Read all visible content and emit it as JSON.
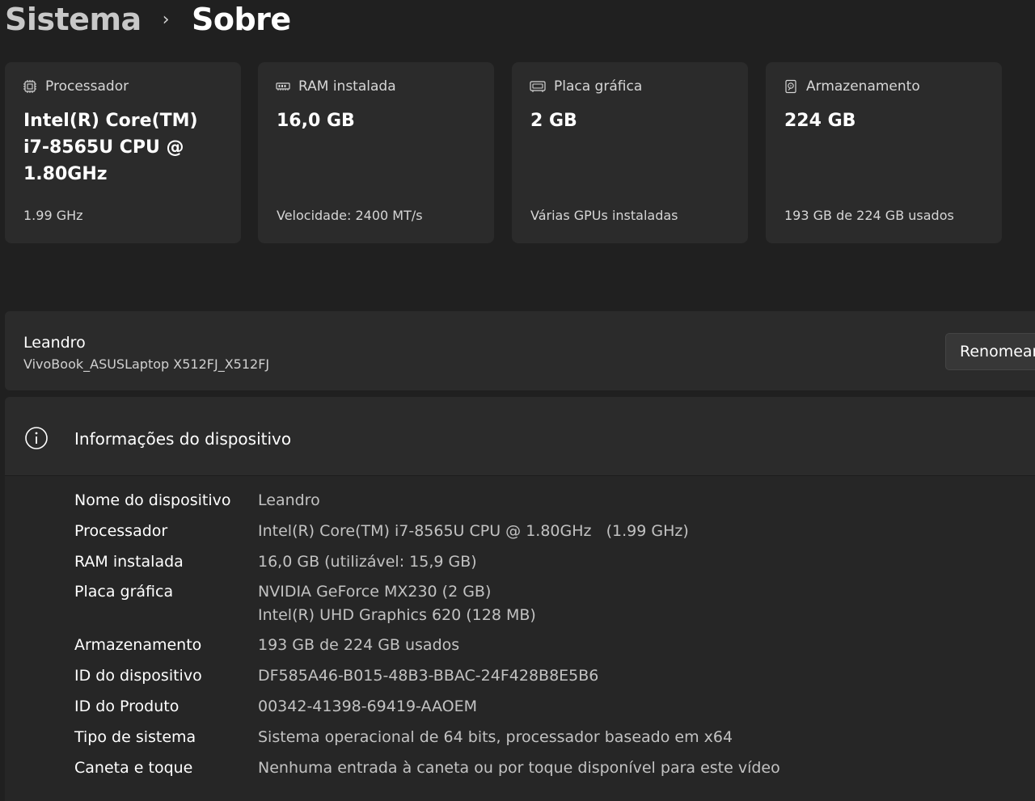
{
  "breadcrumb": {
    "parent": "Sistema",
    "separator": "›",
    "current": "Sobre"
  },
  "spec_cards": [
    {
      "icon": "processor-chip-icon",
      "title": "Processador",
      "value": "Intel(R) Core(TM) i7-8565U CPU @ 1.80GHz",
      "sub": "1.99 GHz"
    },
    {
      "icon": "ram-memory-icon",
      "title": "RAM instalada",
      "value": "16,0 GB",
      "sub": "Velocidade: 2400 MT/s"
    },
    {
      "icon": "graphics-card-icon",
      "title": "Placa gráfica",
      "value": "2 GB",
      "sub": "Várias GPUs instaladas"
    },
    {
      "icon": "storage-drive-icon",
      "title": "Armazenamento",
      "value": "224 GB",
      "sub": "193 GB de 224 GB usados"
    }
  ],
  "device": {
    "name": "Leandro",
    "model": "VivoBook_ASUSLaptop X512FJ_X512FJ",
    "rename_label": "Renomear"
  },
  "device_info": {
    "icon": "info-circle-icon",
    "title": "Informações do dispositivo",
    "rows": [
      {
        "label": "Nome do dispositivo",
        "value": "Leandro"
      },
      {
        "label": "Processador",
        "value": "Intel(R) Core(TM) i7-8565U CPU @ 1.80GHz   (1.99 GHz)"
      },
      {
        "label": "RAM instalada",
        "value": "16,0 GB (utilizável: 15,9 GB)"
      },
      {
        "label": "Placa gráfica",
        "value": "NVIDIA GeForce MX230 (2 GB)",
        "value2": "Intel(R) UHD Graphics 620 (128 MB)"
      },
      {
        "label": "Armazenamento",
        "value": "193 GB de 224 GB usados"
      },
      {
        "label": "ID do dispositivo",
        "value": "DF585A46-B015-48B3-BBAC-24F428B8E5B6"
      },
      {
        "label": "ID do Produto",
        "value": "00342-41398-69419-AAOEM"
      },
      {
        "label": "Tipo de sistema",
        "value": "Sistema operacional de 64 bits, processador baseado em x64"
      },
      {
        "label": "Caneta e toque",
        "value": "Nenhuma entrada à caneta ou por toque disponível para este vídeo"
      }
    ]
  }
}
